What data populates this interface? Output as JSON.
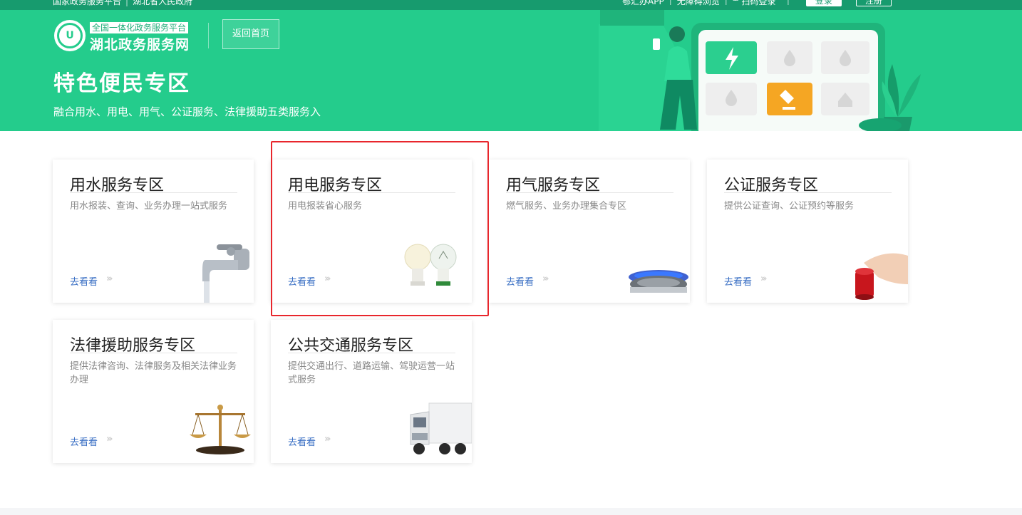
{
  "topbar": {
    "left_links": [
      "国家政务服务平台",
      "湖北省人民政府"
    ],
    "app_link": "鄂汇办APP",
    "accessibility": "无障碍浏览",
    "scan_login": "扫码登录",
    "login": "登录",
    "register": "注册"
  },
  "header": {
    "logo_subtitle": "全国一体化政务服务平台",
    "logo_title": "湖北政务服务网",
    "back_home": "返回首页"
  },
  "banner": {
    "title": "特色便民专区",
    "subtitle": "融合用水、用电、用气、公证服务、法律援助五类服务入"
  },
  "cards": [
    {
      "title": "用水服务专区",
      "desc": "用水报装、查询、业务办理一站式服务",
      "link": "去看看",
      "image": "faucet-image"
    },
    {
      "title": "用电服务专区",
      "desc": "用电报装省心服务",
      "link": "去看看",
      "image": "bulb-image"
    },
    {
      "title": "用气服务专区",
      "desc": "燃气服务、业务办理集合专区",
      "link": "去看看",
      "image": "gas-burner-image"
    },
    {
      "title": "公证服务专区",
      "desc": "提供公证查询、公证预约等服务",
      "link": "去看看",
      "image": "stamp-image"
    },
    {
      "title": "法律援助服务专区",
      "desc": "提供法律咨询、法律服务及相关法律业务办理",
      "link": "去看看",
      "image": "scales-image"
    },
    {
      "title": "公共交通服务专区",
      "desc": "提供交通出行、道路运输、驾驶运营一站式服务",
      "link": "去看看",
      "image": "truck-image"
    }
  ],
  "colors": {
    "brand": "#24cc8c",
    "topbar": "#179b6e",
    "link": "#3a6fc4",
    "highlight": "#e8262c"
  }
}
